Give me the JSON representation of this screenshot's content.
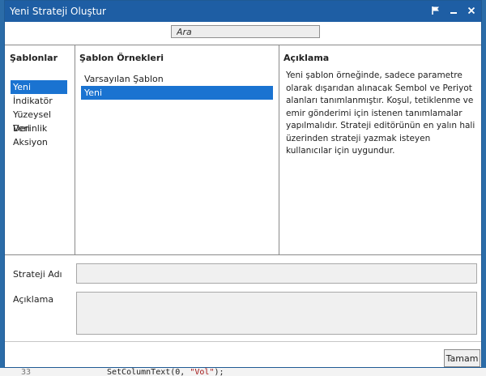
{
  "window": {
    "title": "Yeni Strateji Oluştur"
  },
  "search": {
    "placeholder": "Ara"
  },
  "templates": {
    "header": "Şablonlar",
    "items": [
      "Yeni",
      "İndikatör",
      "Yüzeysel Veri",
      "Derinlik",
      "Aksiyon"
    ],
    "selected": "Yeni"
  },
  "examples": {
    "header": "Şablon Örnekleri",
    "items": [
      "Varsayılan Şablon",
      "Yeni"
    ],
    "selected": "Yeni"
  },
  "description": {
    "header": "Açıklama",
    "text": "Yeni şablon örneğinde, sadece parametre olarak dışarıdan alınacak Sembol ve Periyot alanları tanımlanmıştır. Koşul, tetiklenme ve emir gönderimi için istenen tanımlamalar yapılmalıdır. Strateji editörünün en yalın hali üzerinden strateji yazmak isteyen kullanıcılar için uygundur."
  },
  "form": {
    "name_label": "Strateji Adı",
    "name_value": "",
    "desc_label": "Açıklama",
    "desc_value": ""
  },
  "buttons": {
    "ok": "Tamam"
  },
  "background": {
    "line_number": "33",
    "code_prefix": "SetColumnText(0, ",
    "code_string": "\"Vol\"",
    "code_suffix": ");"
  }
}
